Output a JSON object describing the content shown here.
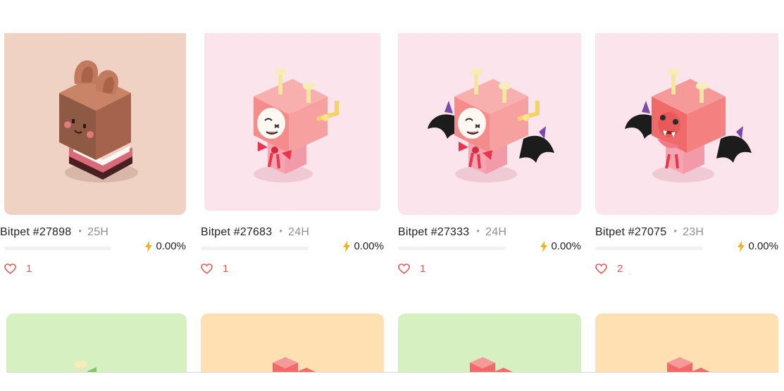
{
  "cards": [
    {
      "name": "Bitpet #27898",
      "age": "25H",
      "energy": "0.00%",
      "likes": "1",
      "bg": "#f0d2c4"
    },
    {
      "name": "Bitpet #27683",
      "age": "24H",
      "energy": "0.00%",
      "likes": "1",
      "bg": "#fce4ec"
    },
    {
      "name": "Bitpet #27333",
      "age": "24H",
      "energy": "0.00%",
      "likes": "1",
      "bg": "#fce4ec"
    },
    {
      "name": "Bitpet #27075",
      "age": "23H",
      "energy": "0.00%",
      "likes": "2",
      "bg": "#fce4ec"
    }
  ],
  "row2_cards": [
    {
      "bg": "#d6f0c2"
    },
    {
      "bg": "#ffe0b3"
    },
    {
      "bg": "#d6f0c2"
    },
    {
      "bg": "#ffe0b3"
    }
  ],
  "colors": {
    "accent_heart": "#e05a5a",
    "bolt": "#f5b324",
    "separator": "#9a9a9a"
  },
  "icons": {
    "energy": "bolt-icon",
    "likes": "heart-icon"
  }
}
